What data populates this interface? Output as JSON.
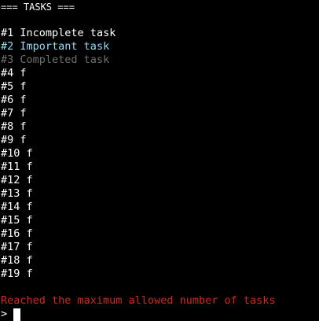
{
  "header": {
    "title": "=== TASKS ==="
  },
  "colors": {
    "background": "#000000",
    "normal": "#ffffff",
    "important": "#9bd8f0",
    "completed": "#6f6f6f",
    "error": "#cc2b1d"
  },
  "tasks": [
    {
      "num": "#1",
      "text": "Incomplete task",
      "status": "incomplete"
    },
    {
      "num": "#2",
      "text": "Important task",
      "status": "important"
    },
    {
      "num": "#3",
      "text": "Completed task",
      "status": "completed"
    },
    {
      "num": "#4",
      "text": "f",
      "status": "normal"
    },
    {
      "num": "#5",
      "text": "f",
      "status": "normal"
    },
    {
      "num": "#6",
      "text": "f",
      "status": "normal"
    },
    {
      "num": "#7",
      "text": "f",
      "status": "normal"
    },
    {
      "num": "#8",
      "text": "f",
      "status": "normal"
    },
    {
      "num": "#9",
      "text": "f",
      "status": "normal"
    },
    {
      "num": "#10",
      "text": "f",
      "status": "normal"
    },
    {
      "num": "#11",
      "text": "f",
      "status": "normal"
    },
    {
      "num": "#12",
      "text": "f",
      "status": "normal"
    },
    {
      "num": "#13",
      "text": "f",
      "status": "normal"
    },
    {
      "num": "#14",
      "text": "f",
      "status": "normal"
    },
    {
      "num": "#15",
      "text": "f",
      "status": "normal"
    },
    {
      "num": "#16",
      "text": "f",
      "status": "normal"
    },
    {
      "num": "#17",
      "text": "f",
      "status": "normal"
    },
    {
      "num": "#18",
      "text": "f",
      "status": "normal"
    },
    {
      "num": "#19",
      "text": "f",
      "status": "normal"
    }
  ],
  "message": {
    "error": "Reached the maximum allowed number of tasks"
  },
  "prompt": {
    "symbol": ">"
  }
}
